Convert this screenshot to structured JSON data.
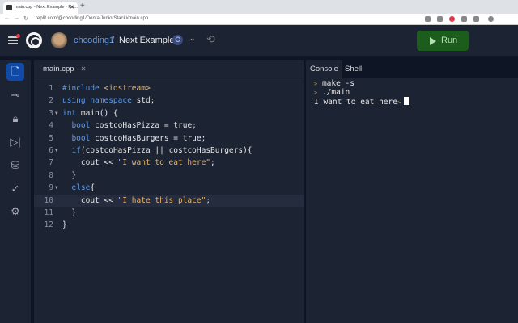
{
  "browser": {
    "tab_title": "main.cpp - Next Example - Re...",
    "url": "replit.com/@chcoding1/DentalJuniorStack#main.cpp"
  },
  "header": {
    "username": "chcoding1",
    "separator": "/",
    "project": "Next Example",
    "language_icon": "C",
    "run_label": "Run",
    "run_color": "#1c5c1c"
  },
  "sidebar": {
    "items": [
      {
        "icon": "file-icon"
      },
      {
        "icon": "version-control-icon"
      },
      {
        "icon": "lock-icon"
      },
      {
        "icon": "debugger-icon"
      },
      {
        "icon": "database-icon"
      },
      {
        "icon": "check-icon"
      },
      {
        "icon": "gear-icon"
      }
    ]
  },
  "editor": {
    "tab": "main.cpp",
    "highlighted_line": 10,
    "lines": [
      {
        "n": "1",
        "fold": false,
        "tokens": [
          [
            "#include ",
            "dir"
          ],
          [
            "<iostream>",
            "str"
          ]
        ]
      },
      {
        "n": "2",
        "fold": false,
        "tokens": [
          [
            "using namespace ",
            "kw"
          ],
          [
            "std;",
            ""
          ]
        ]
      },
      {
        "n": "3",
        "fold": true,
        "tokens": [
          [
            "int ",
            "kw"
          ],
          [
            "main() {",
            ""
          ]
        ]
      },
      {
        "n": "4",
        "fold": false,
        "tokens": [
          [
            "  ",
            ""
          ],
          [
            "bool ",
            "kw"
          ],
          [
            "costcoHasPizza = true;",
            ""
          ]
        ]
      },
      {
        "n": "5",
        "fold": false,
        "tokens": [
          [
            "  ",
            ""
          ],
          [
            "bool ",
            "kw"
          ],
          [
            "costcoHasBurgers = true;",
            ""
          ]
        ]
      },
      {
        "n": "6",
        "fold": true,
        "tokens": [
          [
            "  ",
            ""
          ],
          [
            "if",
            "kw"
          ],
          [
            "(costcoHasPizza || costcoHasBurgers){",
            ""
          ]
        ]
      },
      {
        "n": "7",
        "fold": false,
        "tokens": [
          [
            "    cout << ",
            ""
          ],
          [
            "\"I want to eat here\"",
            "str"
          ],
          [
            ";",
            ""
          ]
        ]
      },
      {
        "n": "8",
        "fold": false,
        "tokens": [
          [
            "  }",
            ""
          ]
        ]
      },
      {
        "n": "9",
        "fold": true,
        "tokens": [
          [
            "  ",
            ""
          ],
          [
            "else",
            "kw"
          ],
          [
            "{",
            ""
          ]
        ]
      },
      {
        "n": "10",
        "fold": false,
        "tokens": [
          [
            "    cout << ",
            ""
          ],
          [
            "\"I hate this place\"",
            "str"
          ],
          [
            ";",
            ""
          ]
        ]
      },
      {
        "n": "11",
        "fold": false,
        "tokens": [
          [
            "  }",
            ""
          ]
        ]
      },
      {
        "n": "12",
        "fold": false,
        "tokens": [
          [
            "}",
            ""
          ]
        ]
      }
    ]
  },
  "console": {
    "tabs": [
      "Console",
      "Shell"
    ],
    "prompt": ">",
    "commands": [
      "make -s",
      "./main"
    ],
    "output": "I want to eat here"
  }
}
